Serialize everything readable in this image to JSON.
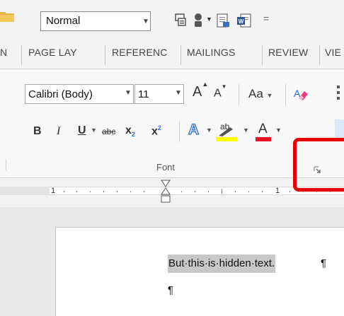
{
  "quick_access": {
    "style_value": "Normal",
    "icons": [
      "folder-icon",
      "format-painter-icon",
      "touch-mode-icon",
      "new-document-icon",
      "word-document-icon",
      "customize-qat-icon"
    ]
  },
  "tabs": [
    "N",
    "PAGE LAY",
    "REFERENC",
    "MAILINGS",
    "REVIEW",
    "VIE"
  ],
  "font_group": {
    "font_name": "Calibri (Body)",
    "font_size": "11",
    "label": "Font",
    "grow_font": "A",
    "shrink_font": "A",
    "change_case": "Aa",
    "bold": "B",
    "italic": "I",
    "underline": "U",
    "strikethrough": "abc",
    "subscript": "x",
    "subscript_mark": "2",
    "superscript": "x",
    "superscript_mark": "2",
    "highlight": "ab",
    "font_color": "A"
  },
  "ruler": {
    "number": "1"
  },
  "document": {
    "hidden_text": "But·this·is·hidden·text.",
    "pilcrow": "¶"
  },
  "colors": {
    "highlight_yellow": "#ffff00",
    "font_color_red": "#e81123",
    "annotation_red": "#e80000",
    "hidden_text_shade": "#c8c8c8"
  }
}
